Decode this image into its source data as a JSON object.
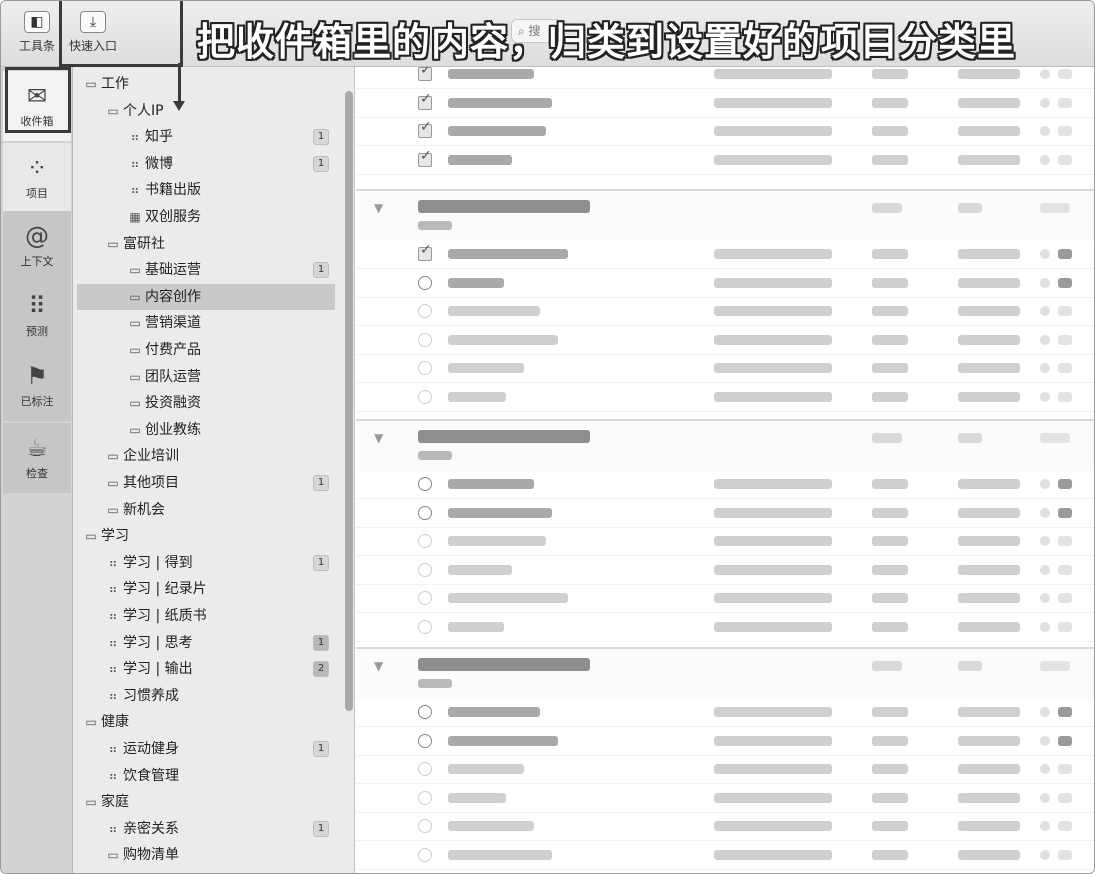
{
  "toolbar": {
    "toolbar_label": "工具条",
    "quick_entry_label": "快速入口",
    "search_stub": "搜"
  },
  "overlay_title": "把收件箱里的内容，归类到设置好的项目分类里",
  "perspectives": [
    {
      "label": "收件箱",
      "icon": "inbox-icon",
      "glyph": "✉"
    },
    {
      "label": "项目",
      "icon": "projects-icon",
      "glyph": "⁘"
    },
    {
      "label": "上下文",
      "icon": "context-icon",
      "glyph": "@"
    },
    {
      "label": "预测",
      "icon": "forecast-icon",
      "glyph": "⠿"
    },
    {
      "label": "已标注",
      "icon": "flag-icon",
      "glyph": "⚑"
    },
    {
      "label": "检查",
      "icon": "review-icon",
      "glyph": "☕"
    }
  ],
  "sidebar": {
    "items": [
      {
        "label": "工作",
        "level": 0,
        "kind": "folder-open",
        "badge": ""
      },
      {
        "label": "个人IP",
        "level": 1,
        "kind": "folder-open",
        "badge": ""
      },
      {
        "label": "知乎",
        "level": 2,
        "kind": "list",
        "badge": "1"
      },
      {
        "label": "微博",
        "level": 2,
        "kind": "list",
        "badge": "1"
      },
      {
        "label": "书籍出版",
        "level": 2,
        "kind": "list",
        "badge": ""
      },
      {
        "label": "双创服务",
        "level": 2,
        "kind": "grid",
        "badge": ""
      },
      {
        "label": "富研社",
        "level": 1,
        "kind": "folder-open",
        "badge": ""
      },
      {
        "label": "基础运营",
        "level": 2,
        "kind": "folder",
        "badge": "1"
      },
      {
        "label": "内容创作",
        "level": 2,
        "kind": "folder",
        "badge": "",
        "selected": true
      },
      {
        "label": "营销渠道",
        "level": 2,
        "kind": "folder",
        "badge": ""
      },
      {
        "label": "付费产品",
        "level": 2,
        "kind": "folder",
        "badge": ""
      },
      {
        "label": "团队运营",
        "level": 2,
        "kind": "folder",
        "badge": ""
      },
      {
        "label": "投资融资",
        "level": 2,
        "kind": "folder",
        "badge": ""
      },
      {
        "label": "创业教练",
        "level": 2,
        "kind": "folder",
        "badge": ""
      },
      {
        "label": "企业培训",
        "level": 1,
        "kind": "folder",
        "badge": ""
      },
      {
        "label": "其他项目",
        "level": 1,
        "kind": "folder",
        "badge": "1"
      },
      {
        "label": "新机会",
        "level": 1,
        "kind": "folder",
        "badge": ""
      },
      {
        "label": "学习",
        "level": 0,
        "kind": "folder-open",
        "badge": ""
      },
      {
        "label": "学习 | 得到",
        "level": 1,
        "kind": "list",
        "badge": "1"
      },
      {
        "label": "学习 | 纪录片",
        "level": 1,
        "kind": "list",
        "badge": ""
      },
      {
        "label": "学习 | 纸质书",
        "level": 1,
        "kind": "list",
        "badge": ""
      },
      {
        "label": "学习 | 思考",
        "level": 1,
        "kind": "list",
        "badge": "1"
      },
      {
        "label": "学习 | 输出",
        "level": 1,
        "kind": "list",
        "badge": "2"
      },
      {
        "label": "习惯养成",
        "level": 1,
        "kind": "list",
        "badge": ""
      },
      {
        "label": "健康",
        "level": 0,
        "kind": "folder-open",
        "badge": ""
      },
      {
        "label": "运动健身",
        "level": 1,
        "kind": "list",
        "badge": "1"
      },
      {
        "label": "饮食管理",
        "level": 1,
        "kind": "list",
        "badge": ""
      },
      {
        "label": "家庭",
        "level": 0,
        "kind": "folder-open",
        "badge": ""
      },
      {
        "label": "亲密关系",
        "level": 1,
        "kind": "list",
        "badge": "1"
      },
      {
        "label": "购物清单",
        "level": 1,
        "kind": "folder",
        "badge": ""
      }
    ]
  },
  "icons": {
    "folder-open": "▭",
    "folder": "▭",
    "list": "⠶",
    "grid": "▦"
  },
  "colors": {
    "annotation": "#3a3a3a",
    "selected_row": "#c9c9c9"
  }
}
